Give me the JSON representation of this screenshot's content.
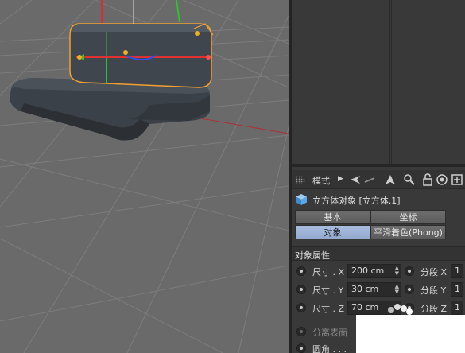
{
  "toolbar": {
    "mode_label": "模式"
  },
  "object": {
    "title": "立方体对象 [立方体.1]"
  },
  "tabs": [
    {
      "label": "基本",
      "active": false
    },
    {
      "label": "坐标",
      "active": false
    },
    {
      "label": "对象",
      "active": true
    },
    {
      "label": "平滑着色(Phong)",
      "active": false
    }
  ],
  "section_title": "对象属性",
  "properties": [
    {
      "label": "尺寸 . X",
      "value": "200 cm",
      "seg_label": "分段 X",
      "seg_value": "1"
    },
    {
      "label": "尺寸 . Y",
      "value": "30 cm",
      "seg_label": "分段 Y",
      "seg_value": "1"
    },
    {
      "label": "尺寸 . Z",
      "value": "70 cm",
      "seg_label": "分段 Z",
      "seg_value": "1"
    }
  ],
  "separate_surfaces": {
    "label": "分离表面"
  },
  "fillet": {
    "label": "圆角 . . ."
  },
  "colors": {
    "viewport_bg": "#6a6a6a",
    "selection_outline": "#f0a030",
    "axis_x": "#e03030",
    "axis_y": "#30c030",
    "axis_z": "#3050e0",
    "tab_active": "#9fb4d8"
  }
}
